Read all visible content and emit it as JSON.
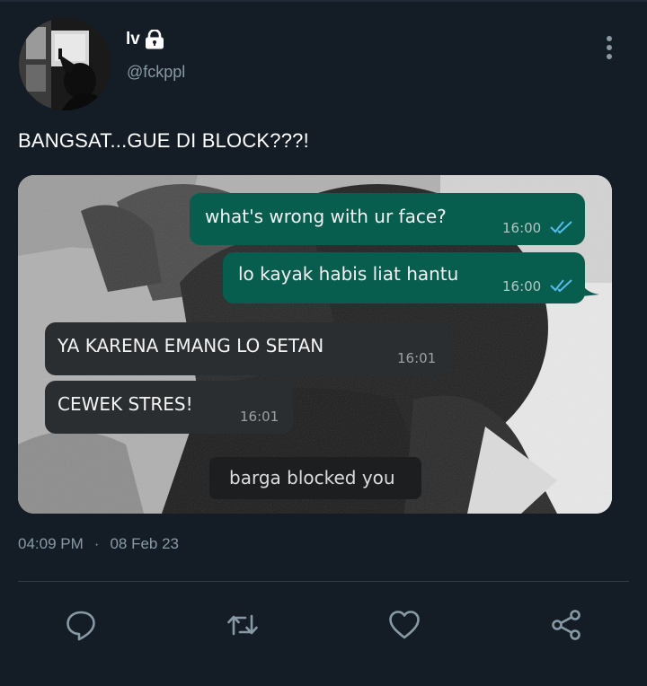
{
  "user": {
    "name": "lv",
    "handle": "@fckppl"
  },
  "tweet": {
    "text": "BANGSAT...GUE DI BLOCK???!",
    "time": "04:09 PM",
    "separator": "·",
    "date": "08 Feb 23"
  },
  "chat": {
    "messages": [
      {
        "text": "what's wrong with ur face?",
        "time": "16:00",
        "direction": "outgoing",
        "status": "read"
      },
      {
        "text": "lo kayak habis liat hantu",
        "time": "16:00",
        "direction": "outgoing",
        "status": "read"
      },
      {
        "text": "YA KARENA EMANG LO SETAN",
        "time": "16:01",
        "direction": "incoming"
      },
      {
        "text": "CEWEK STRES!",
        "time": "16:01",
        "direction": "incoming"
      }
    ],
    "system_notice": "barga blocked you"
  },
  "actions": [
    "reply-icon",
    "retweet-icon",
    "like-icon",
    "share-icon"
  ],
  "colors": {
    "background": "#141d26",
    "secondary_text": "#8899a6",
    "outgoing_bubble": "#075e4f",
    "incoming_bubble": "#2a2e31",
    "read_ticks": "#53bdeb"
  }
}
